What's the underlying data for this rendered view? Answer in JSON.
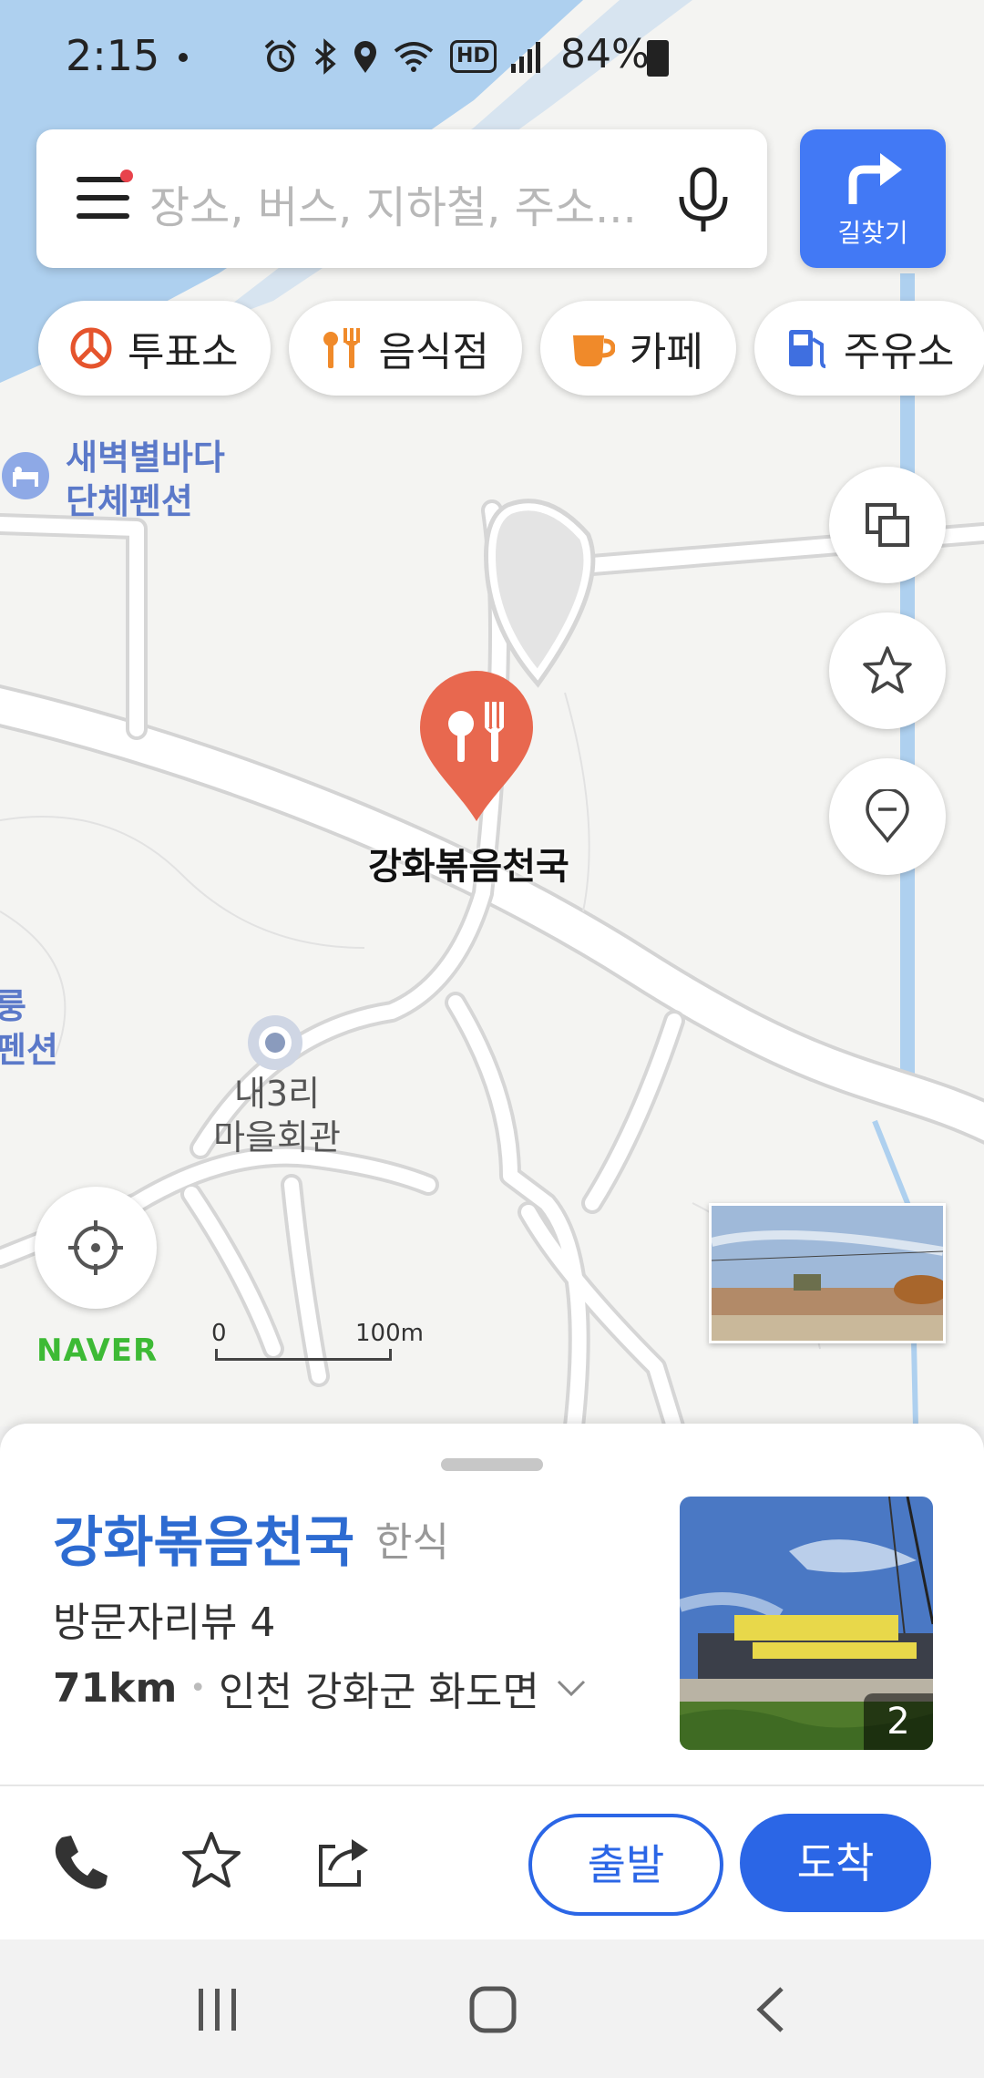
{
  "status_bar": {
    "time": "2:15",
    "battery": "84%",
    "icons": [
      "alarm-icon",
      "bluetooth-icon",
      "location-icon",
      "wifi-icon",
      "hd-voice-icon",
      "signal-icon",
      "battery-icon"
    ],
    "hd_label": "HD"
  },
  "search": {
    "placeholder": "장소, 버스, 지하철, 주소..."
  },
  "route_button": {
    "label": "길찾기"
  },
  "categories": [
    {
      "label": "투표소",
      "icon": "polling-station-icon",
      "color": "#e5542d"
    },
    {
      "label": "음식점",
      "icon": "restaurant-icon",
      "color": "#f08a2a"
    },
    {
      "label": "카페",
      "icon": "cafe-icon",
      "color": "#f08a2a"
    },
    {
      "label": "주유소",
      "icon": "gas-station-icon",
      "color": "#3f6fe0"
    }
  ],
  "map": {
    "pois": [
      {
        "name_line1": "새벽별바다",
        "name_line2": "단체펜션"
      },
      {
        "name_line1": "내3리",
        "name_line2": "마을회관"
      }
    ],
    "edge_label_line1": "룽",
    "edge_label_line2": "펜션",
    "selected_place": "강화볶음천국",
    "scale_start": "0",
    "scale_end": "100m",
    "logo": "NAVER"
  },
  "place": {
    "name": "강화볶음천국",
    "category": "한식",
    "reviews": "방문자리뷰 4",
    "distance": "71km",
    "address": "인천 강화군 화도면",
    "photo_count": "2"
  },
  "actions": {
    "start_label": "출발",
    "arrive_label": "도착"
  },
  "colors": {
    "accent": "#2b66e6",
    "route_button": "#4279f5",
    "marker": "#e8684f",
    "naver_green": "#3dba35",
    "water": "#aed0ef"
  }
}
